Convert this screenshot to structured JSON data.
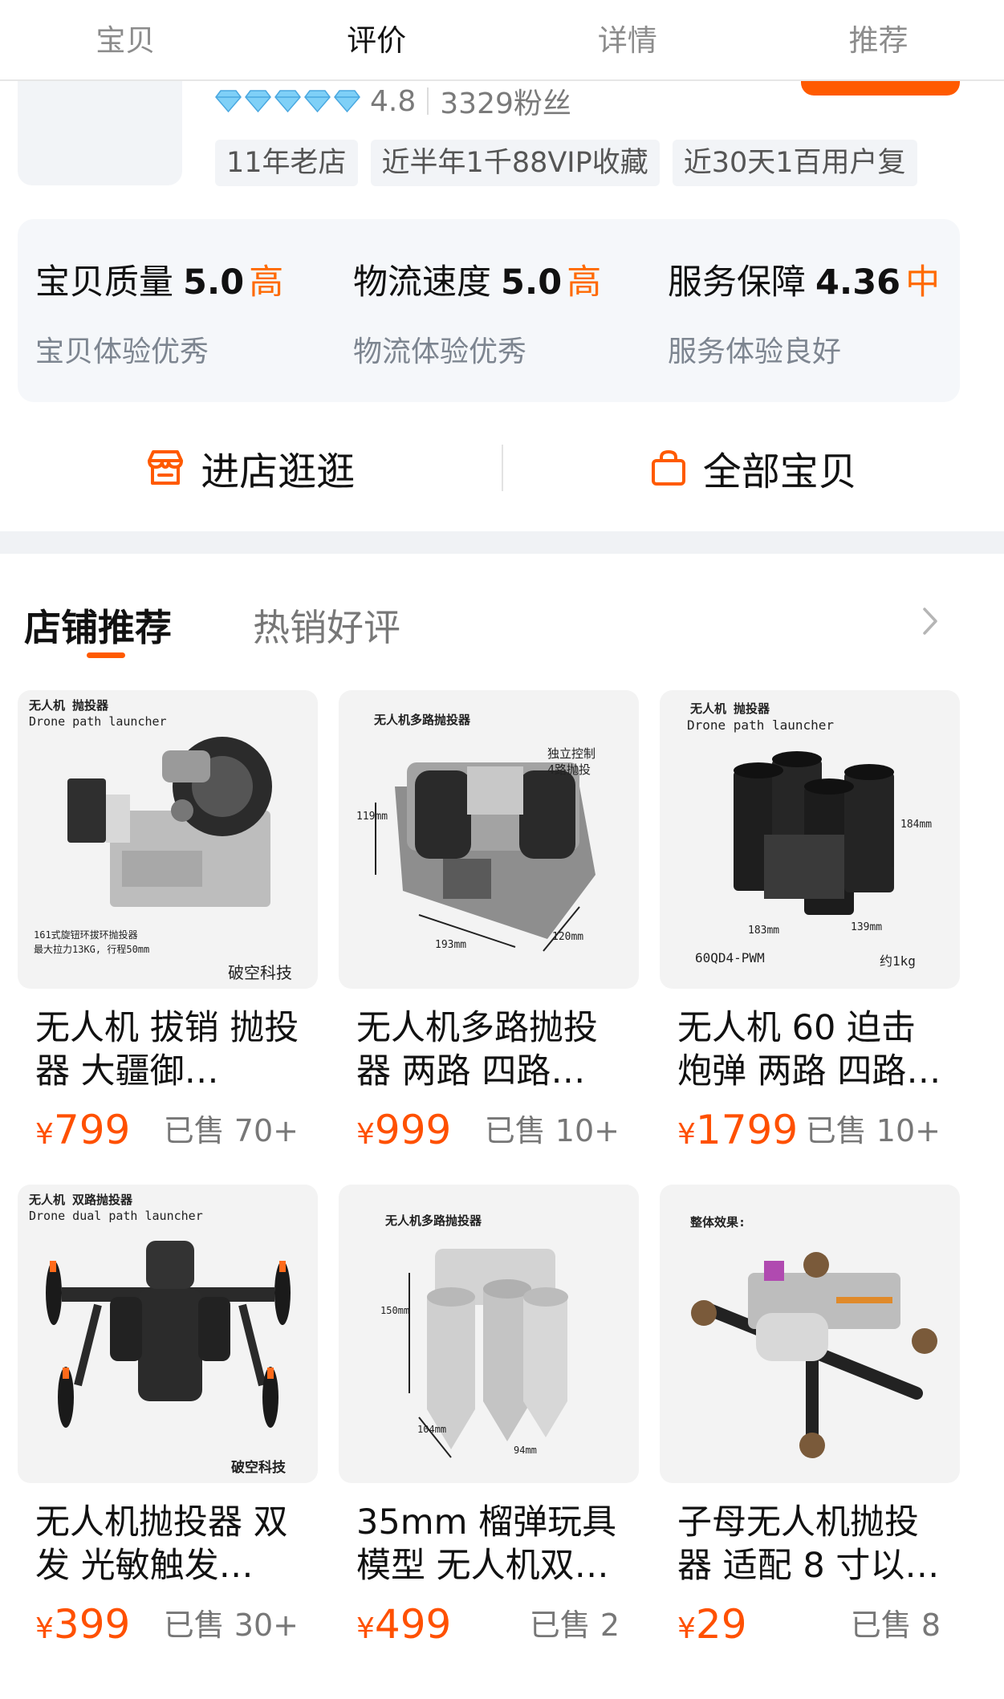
{
  "top_tabs": [
    {
      "label": "宝贝"
    },
    {
      "label": "评价"
    },
    {
      "label": "详情"
    },
    {
      "label": "推荐"
    }
  ],
  "shop": {
    "rating": "4.8",
    "followers": "3329粉丝",
    "diamond_count": 5,
    "tags": [
      "11年老店",
      "近半年1千88VIP收藏",
      "近30天1百用户复"
    ]
  },
  "scores": [
    {
      "name": "宝贝质量",
      "score": "5.0",
      "level": "高",
      "desc": "宝贝体验优秀"
    },
    {
      "name": "物流速度",
      "score": "5.0",
      "level": "高",
      "desc": "物流体验优秀"
    },
    {
      "name": "服务保障",
      "score": "4.36",
      "level": "中",
      "desc": "服务体验良好"
    }
  ],
  "actions": {
    "visit_store": "进店逛逛",
    "all_items": "全部宝贝"
  },
  "recommend": {
    "tab_active": "店铺推荐",
    "tab_inactive": "热销好评"
  },
  "products": [
    {
      "title": "无人机 拔销 抛投器 大疆御…",
      "currency": "¥",
      "price": "799",
      "sold": "已售 70+",
      "image_text": [
        "无人机 抛投器",
        "Drone  path launcher",
        "161式旋钮环拔环抛投器",
        "最大拉力13KG, 行程50mm",
        "破空科技"
      ]
    },
    {
      "title": "无人机多路抛投器 两路 四路…",
      "currency": "¥",
      "price": "999",
      "sold": "已售 10+",
      "image_text": [
        "无人机多路抛投器",
        "独立控制",
        "4路抛投",
        "119mm",
        "193mm",
        "120mm"
      ]
    },
    {
      "title": "无人机 60 迫击炮弹 两路 四路…",
      "currency": "¥",
      "price": "1799",
      "sold": "已售 10+",
      "image_text": [
        "无人机 抛投器",
        "Drone  path launcher",
        "184mm",
        "183mm",
        "139mm",
        "60QD4-PWM",
        "约1kg"
      ]
    },
    {
      "title": "无人机抛投器 双发 光敏触发…",
      "currency": "¥",
      "price": "399",
      "sold": "已售 30+",
      "image_text": [
        "无人机 双路抛投器",
        "Drone dual path launcher",
        "破空科技"
      ]
    },
    {
      "title": "35mm 榴弹玩具模型 无人机双…",
      "currency": "¥",
      "price": "499",
      "sold": "已售 2",
      "image_text": [
        "无人机多路抛投器",
        "150mm",
        "104mm",
        "94mm"
      ]
    },
    {
      "title": "子母无人机抛投器 适配 8 寸以…",
      "currency": "¥",
      "price": "29",
      "sold": "已售 8",
      "image_text": [
        "整体效果:"
      ]
    }
  ],
  "colors": {
    "accent": "#ff5000",
    "level": "#ff6a00",
    "diamond": "#6ec6f5"
  },
  "icons": {
    "store": "store-icon",
    "bag": "shopping-bag-icon",
    "more": "chevron-right-icon",
    "diamond": "diamond-icon"
  }
}
